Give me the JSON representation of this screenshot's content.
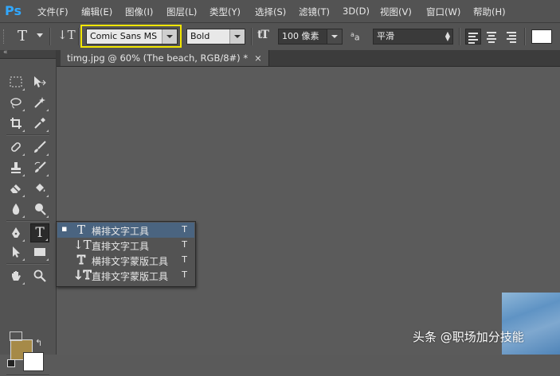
{
  "app": {
    "logo": "Ps"
  },
  "menu": [
    "文件(F)",
    "编辑(E)",
    "图像(I)",
    "图层(L)",
    "类型(Y)",
    "选择(S)",
    "滤镜(T)",
    "3D(D)",
    "视图(V)",
    "窗口(W)",
    "帮助(H)"
  ],
  "options": {
    "tool_glyph": "T",
    "orientation_glyph": "↓T",
    "font_family": "Comic Sans MS",
    "font_style": "Bold",
    "size_glyph": "tT",
    "font_size": "100 像素",
    "aa_glyph": "a",
    "aa_small": "a",
    "anti_alias": "平滑",
    "text_color": "#ffffff"
  },
  "document_tab": {
    "title": "timg.jpg @ 60% (The beach, RGB/8#) *",
    "close": "×"
  },
  "flyout": {
    "items": [
      {
        "bullet": "▪",
        "icon": "T",
        "label": "横排文字工具",
        "shortcut": "T"
      },
      {
        "bullet": "",
        "icon": "↓T",
        "label": "直排文字工具",
        "shortcut": "T"
      },
      {
        "bullet": "",
        "icon": "T",
        "label": "横排文字蒙版工具",
        "shortcut": "T"
      },
      {
        "bullet": "",
        "icon": "↓T",
        "label": "直排文字蒙版工具",
        "shortcut": "T"
      }
    ]
  },
  "colors": {
    "foreground": "#a68a48",
    "background": "#ffffff",
    "highlight": "#f2e600"
  },
  "watermark": "头条 @职场加分技能"
}
